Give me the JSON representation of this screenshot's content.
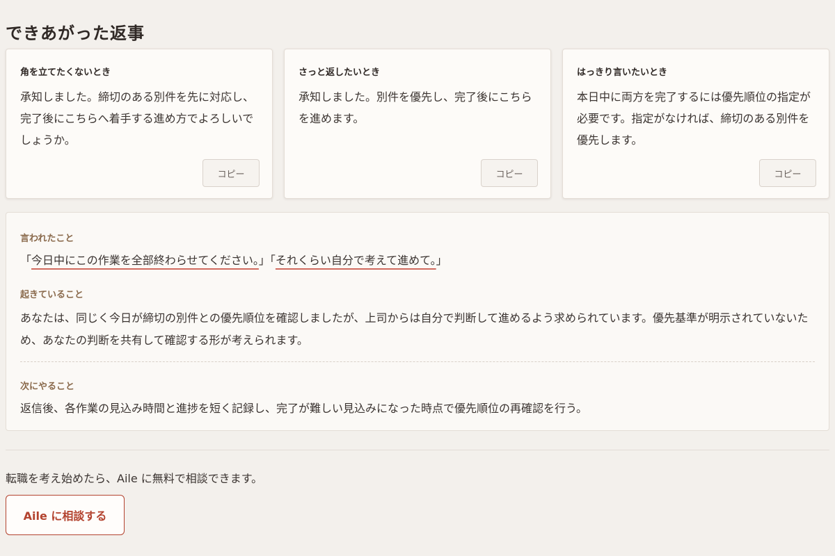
{
  "section_title": "できあがった返事",
  "cards": [
    {
      "label": "角を立てたくないとき",
      "body": "承知しました。締切のある別件を先に対応し、完了後にこちらへ着手する進め方でよろしいでしょうか。",
      "copy_label": "コピー"
    },
    {
      "label": "さっと返したいとき",
      "body": "承知しました。別件を優先し、完了後にこちらを進めます。",
      "copy_label": "コピー"
    },
    {
      "label": "はっきり言いたいとき",
      "body": "本日中に両方を完了するには優先順位の指定が必要です。指定がなければ、締切のある別件を優先します。",
      "copy_label": "コピー"
    }
  ],
  "detail": {
    "said_label": "言われたこと",
    "said_quotes": [
      "今日中にこの作業を全部終わらせてください。",
      "それくらい自分で考えて進めて。"
    ],
    "happening_label": "起きていること",
    "happening_text": "あなたは、同じく今日が締切の別件との優先順位を確認しましたが、上司からは自分で判断して進めるよう求められています。優先基準が明示されていないため、あなたの判断を共有して確認する形が考えられます。",
    "next_label": "次にやること",
    "next_text": "返信後、各作業の見込み時間と進捗を短く記録し、完了が難しい見込みになった時点で優先順位の再確認を行う。"
  },
  "footer": {
    "text": "転職を考え始めたら、Aile に無料で相談できます。",
    "cta_label": "Aile に相談する"
  },
  "colors": {
    "background": "#f3f0ec",
    "accent": "#b3432f",
    "underline": "#d06a5e",
    "label_brown": "#8a6a4c"
  }
}
